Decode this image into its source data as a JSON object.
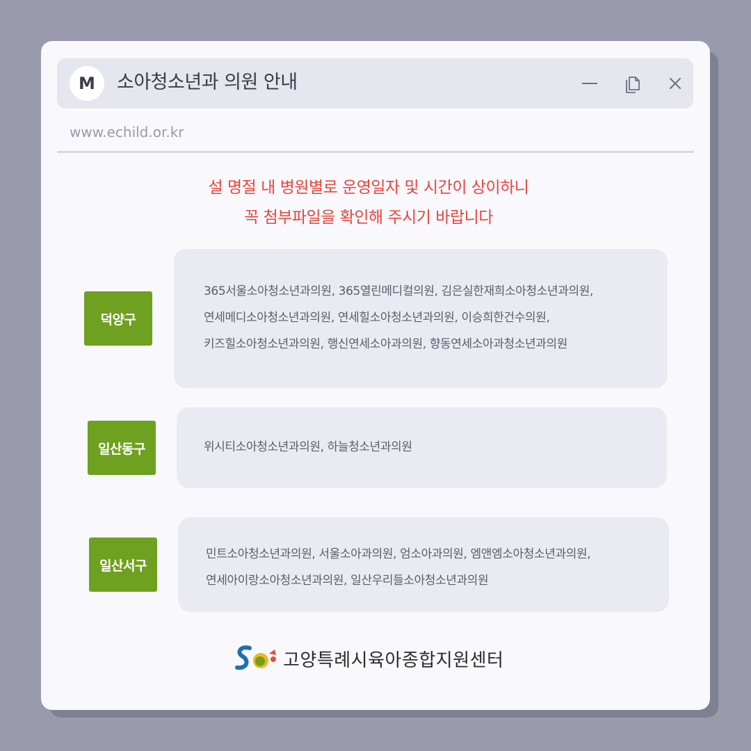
{
  "window": {
    "avatar_letter": "M",
    "title": "소아청소년과 의원 안내",
    "url": "www.echild.or.kr",
    "controls": [
      "minimize-icon",
      "copy-icon",
      "close-icon"
    ]
  },
  "notice": {
    "line1": "설 명절 내 병원별로 운영일자 및 시간이 상이하니",
    "line2": "꼭 첨부파일을 확인해 주시기 바랍니다",
    "color": "#e8453c"
  },
  "districts": [
    {
      "name": "덕양구",
      "lines": [
        "365서울소아청소년과의원, 365열린메디컬의원, 김은실한재희소아청소년과의원,",
        "연세메디소아청소년과의원, 연세힐소아청소년과의원, 이승희한건수의원,",
        "키즈힐소아청소년과의원, 행신연세소아과의원, 향동연세소아과청소년과의원"
      ]
    },
    {
      "name": "일산동구",
      "lines": [
        "위시티소아청소년과의원, 하늘청소년과의원"
      ]
    },
    {
      "name": "일산서구",
      "lines": [
        "민트소아청소년과의원, 서울소아과의원, 엄소아과의원, 엠앤엠소아청소년과의원,",
        "연세아이랑소아청소년과의원, 일산우리들소아청소년과의원"
      ]
    }
  ],
  "footer": {
    "logo_text": "고양특례시육아종합지원센터"
  },
  "colors": {
    "background": "#999aab",
    "window": "#f8f8fd",
    "tag_green": "#6ea11f",
    "card": "#eaeaf3"
  }
}
